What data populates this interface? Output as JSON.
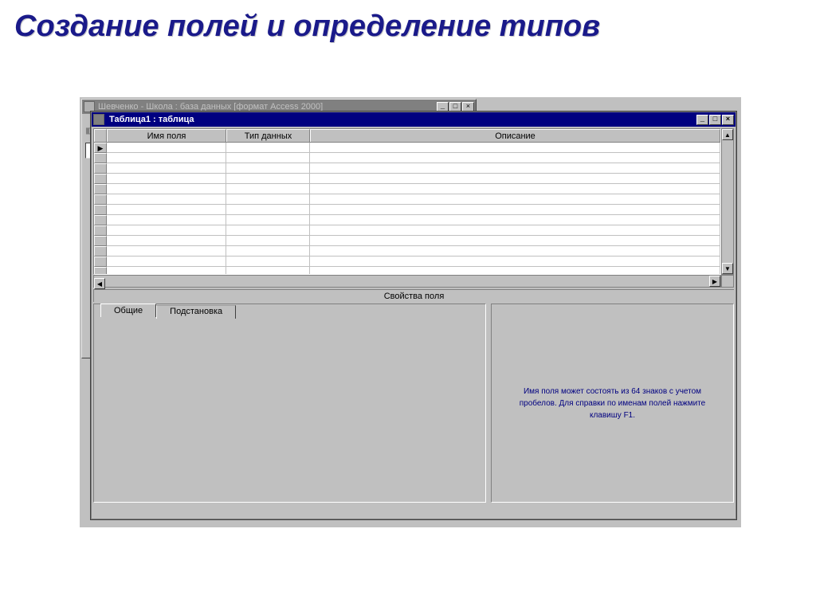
{
  "slide_title": "Создание полей и определение типов",
  "mdi": {
    "title": "Шевченко - Школа : база данных [формат Access 2000]"
  },
  "child": {
    "title": "Таблица1 : таблица"
  },
  "grid": {
    "headers": {
      "field_name": "Имя поля",
      "data_type": "Тип данных",
      "description": "Описание"
    },
    "current_row_marker": "▶"
  },
  "section": {
    "properties": "Свойства поля"
  },
  "tabs": {
    "general": "Общие",
    "lookup": "Подстановка"
  },
  "hint": "Имя поля может состоять из 64 знаков с учетом пробелов.  Для справки по именам полей нажмите клавишу F1.",
  "winbtns": {
    "min": "_",
    "max": "□",
    "close": "×"
  },
  "scroll": {
    "up": "▲",
    "down": "▼",
    "left": "◀",
    "right": "▶"
  }
}
